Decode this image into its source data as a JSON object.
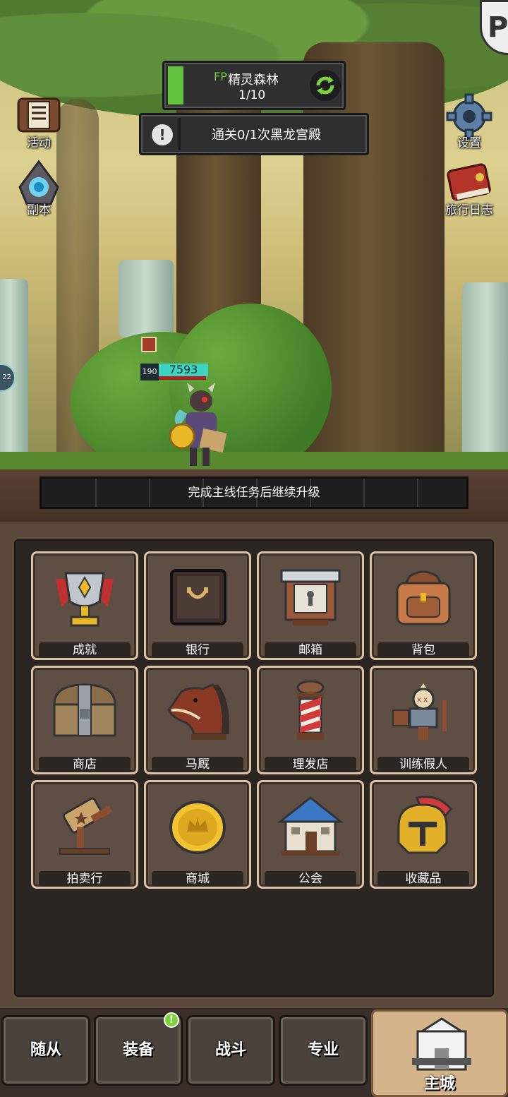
{
  "stage": {
    "fp_label": "FP",
    "name": "精灵森林",
    "progress": "1/10"
  },
  "quest": {
    "text": "通关0/1次黑龙宫殿"
  },
  "side_buttons": {
    "event": "活动",
    "dungeon": "副本",
    "settings": "设置",
    "journal": "旅行日志"
  },
  "hero": {
    "level": "190",
    "hp": "7593",
    "hp_fraction": 0.95
  },
  "left_gear_badge": "22",
  "corner_badge": "P",
  "upgrade_hint": "完成主线任务后继续升级",
  "menu": {
    "tiles": [
      {
        "label": "成就",
        "icon": "trophy-icon"
      },
      {
        "label": "银行",
        "icon": "safe-icon"
      },
      {
        "label": "邮箱",
        "icon": "mailbox-icon"
      },
      {
        "label": "背包",
        "icon": "backpack-icon"
      },
      {
        "label": "商店",
        "icon": "chest-icon"
      },
      {
        "label": "马厩",
        "icon": "horse-icon"
      },
      {
        "label": "理发店",
        "icon": "barber-pole-icon"
      },
      {
        "label": "训练假人",
        "icon": "training-dummy-icon"
      },
      {
        "label": "拍卖行",
        "icon": "gavel-icon"
      },
      {
        "label": "商城",
        "icon": "gold-coin-icon"
      },
      {
        "label": "公会",
        "icon": "guild-house-icon"
      },
      {
        "label": "收藏品",
        "icon": "helmet-icon"
      }
    ]
  },
  "nav": {
    "followers": "随从",
    "equipment": "装备",
    "battle": "战斗",
    "profession": "专业",
    "main_city": "主城",
    "equipment_notification": "!"
  },
  "colors": {
    "stage_green": "#63c33f",
    "hp_teal": "#3fd3c4",
    "tile_border": "#d8c3a4",
    "active_nav": "#d4b48a"
  }
}
